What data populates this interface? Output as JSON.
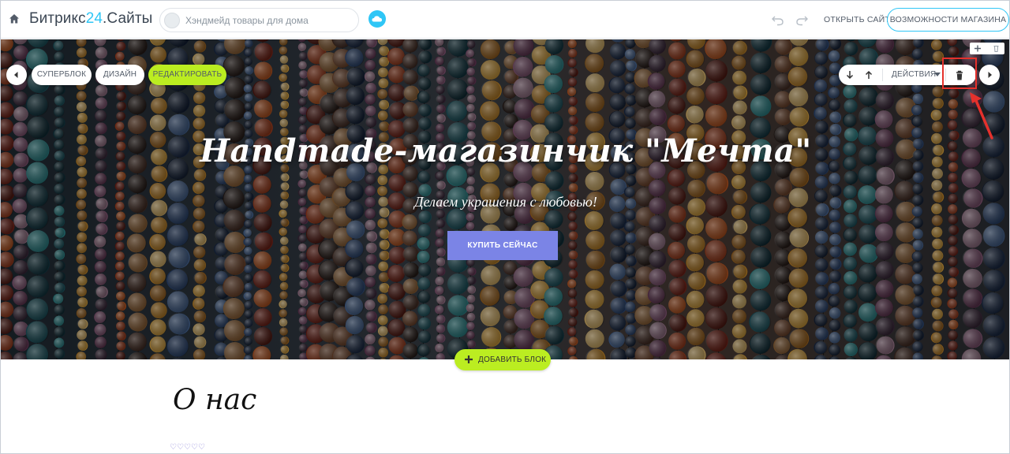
{
  "topbar": {
    "brand_prefix": "Битрикс",
    "brand_accent": "24",
    "brand_suffix": ".Сайты",
    "site_name": "Хэндмейд товары для дома",
    "open_site_label": "ОТКРЫТЬ САЙТ",
    "features_label": "ВОЗМОЖНОСТИ МАГАЗИНА"
  },
  "block_toolbar": {
    "superblock_label": "СУПЕРБЛОК",
    "design_label": "ДИЗАЙН",
    "edit_label": "РЕДАКТИРОВАТЬ",
    "actions_label": "ДЕЙСТВИЯ"
  },
  "hero": {
    "title": "Handmade-магазинчик \"Мечта\"",
    "subtitle": "Делаем украшения с любовью!",
    "button_label": "КУПИТЬ СЕЙЧАС"
  },
  "add_block_label": "ДОБАВИТЬ БЛОК",
  "about": {
    "heading": "О нас",
    "divider": "♡♡♡♡♡"
  },
  "colors": {
    "brand_accent": "#2fc6f6",
    "edit_green": "#bbed21",
    "hero_button": "#7b84e6",
    "highlight_red": "#e5312c"
  },
  "icons": [
    "home-icon",
    "cloud-icon",
    "undo-icon",
    "redo-icon",
    "arrow-left-icon",
    "arrow-right-icon",
    "arrow-down-icon",
    "arrow-up-icon",
    "trash-icon",
    "plus-icon"
  ]
}
